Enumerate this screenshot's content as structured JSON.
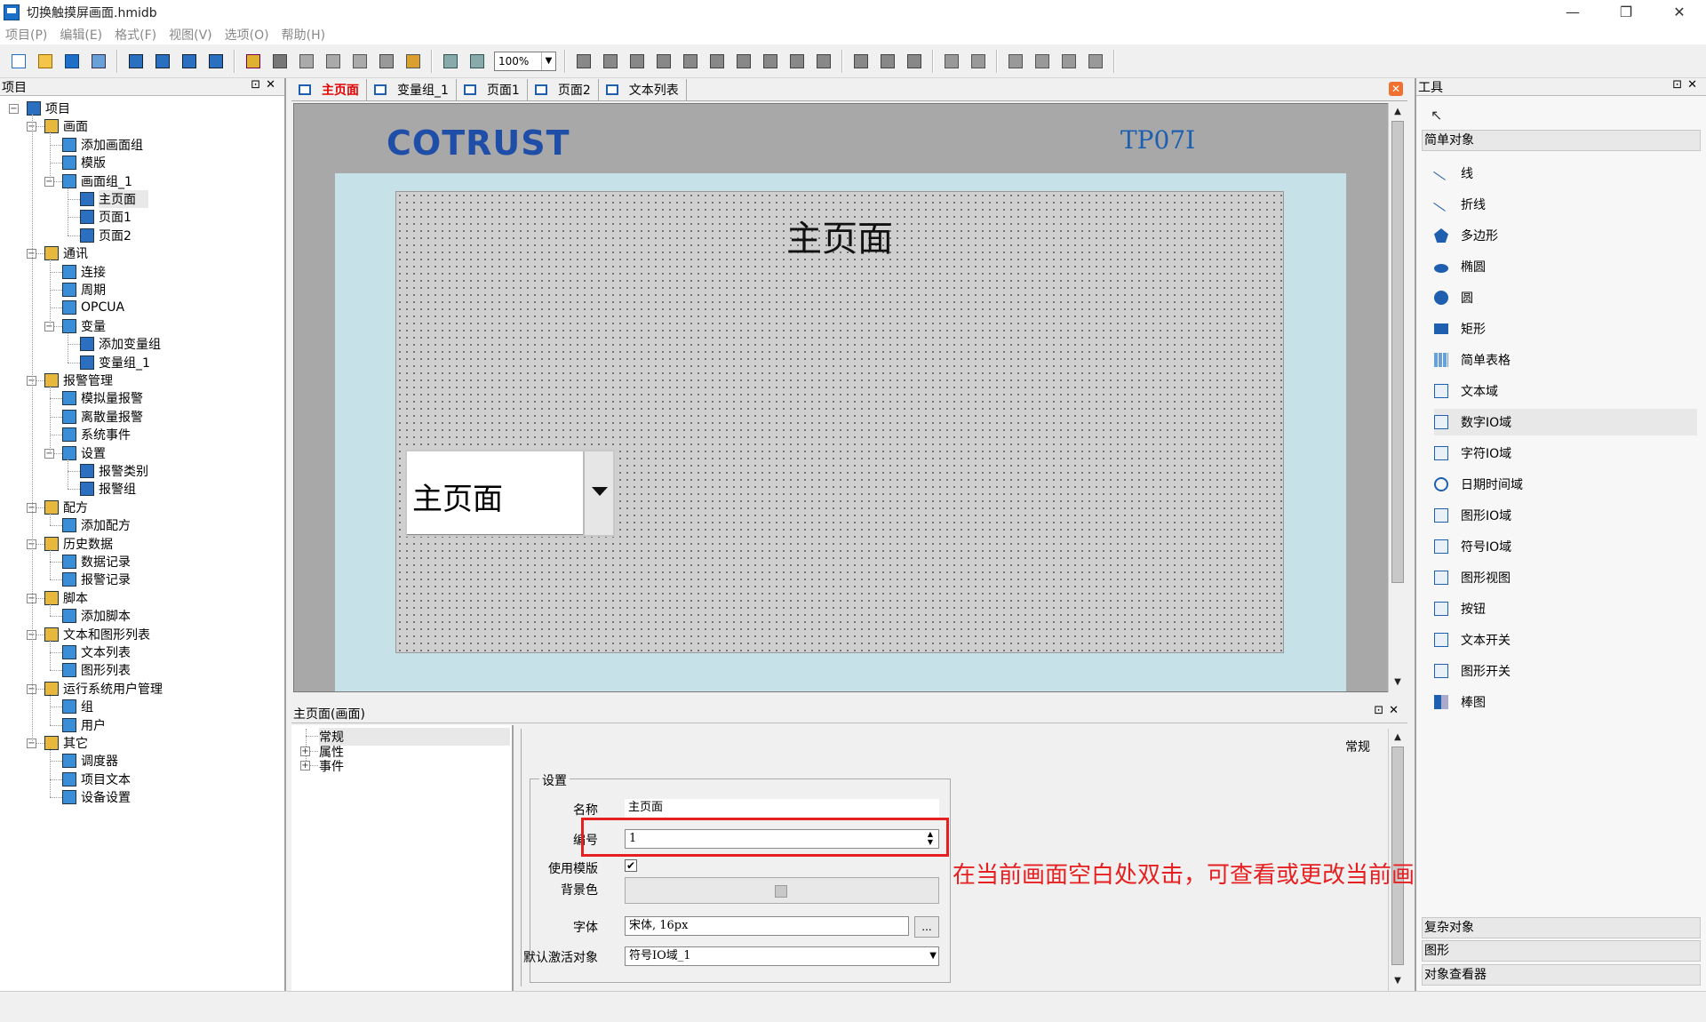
{
  "window": {
    "title": "切换触摸屏画面.hmidb",
    "min": "—",
    "max": "❐",
    "close": "✕"
  },
  "menu": [
    "项目(P)",
    "编辑(E)",
    "格式(F)",
    "视图(V)",
    "选项(O)",
    "帮助(H)"
  ],
  "toolbar": {
    "zoom": "100%"
  },
  "project_panel": {
    "title": "项目"
  },
  "tree": [
    {
      "label": "项目",
      "level": 0,
      "icon": "project-icon",
      "expand": "−"
    },
    {
      "label": "画面",
      "level": 1,
      "icon": "screen-folder-icon",
      "expand": "−"
    },
    {
      "label": "添加画面组",
      "level": 2,
      "icon": "add-screen-group-icon"
    },
    {
      "label": "模版",
      "level": 2,
      "icon": "template-icon"
    },
    {
      "label": "画面组_1",
      "level": 2,
      "icon": "screen-group-icon",
      "expand": "−"
    },
    {
      "label": "主页面",
      "level": 3,
      "icon": "screen-icon",
      "selected": true
    },
    {
      "label": "页面1",
      "level": 3,
      "icon": "screen-icon"
    },
    {
      "label": "页面2",
      "level": 3,
      "icon": "screen-icon"
    },
    {
      "label": "通讯",
      "level": 1,
      "icon": "communication-icon",
      "expand": "−"
    },
    {
      "label": "连接",
      "level": 2,
      "icon": "connection-icon"
    },
    {
      "label": "周期",
      "level": 2,
      "icon": "cycle-icon"
    },
    {
      "label": "OPCUA",
      "level": 2,
      "icon": "opcua-icon"
    },
    {
      "label": "变量",
      "level": 2,
      "icon": "variable-icon",
      "expand": "−"
    },
    {
      "label": "添加变量组",
      "level": 3,
      "icon": "add-variable-group-icon"
    },
    {
      "label": "变量组_1",
      "level": 3,
      "icon": "variable-group-icon"
    },
    {
      "label": "报警管理",
      "level": 1,
      "icon": "alarm-management-icon",
      "expand": "−"
    },
    {
      "label": "模拟量报警",
      "level": 2,
      "icon": "analog-alarm-icon"
    },
    {
      "label": "离散量报警",
      "level": 2,
      "icon": "discrete-alarm-icon"
    },
    {
      "label": "系统事件",
      "level": 2,
      "icon": "system-event-icon"
    },
    {
      "label": "设置",
      "level": 2,
      "icon": "alarm-settings-icon",
      "expand": "−"
    },
    {
      "label": "报警类别",
      "level": 3,
      "icon": "alarm-class-icon"
    },
    {
      "label": "报警组",
      "level": 3,
      "icon": "alarm-group-icon"
    },
    {
      "label": "配方",
      "level": 1,
      "icon": "recipe-icon",
      "expand": "−"
    },
    {
      "label": "添加配方",
      "level": 2,
      "icon": "add-recipe-icon"
    },
    {
      "label": "历史数据",
      "level": 1,
      "icon": "history-data-icon",
      "expand": "−"
    },
    {
      "label": "数据记录",
      "level": 2,
      "icon": "data-log-icon"
    },
    {
      "label": "报警记录",
      "level": 2,
      "icon": "alarm-log-icon"
    },
    {
      "label": "脚本",
      "level": 1,
      "icon": "script-icon",
      "expand": "−"
    },
    {
      "label": "添加脚本",
      "level": 2,
      "icon": "add-script-icon"
    },
    {
      "label": "文本和图形列表",
      "level": 1,
      "icon": "text-graphic-list-icon",
      "expand": "−"
    },
    {
      "label": "文本列表",
      "level": 2,
      "icon": "text-list-icon"
    },
    {
      "label": "图形列表",
      "level": 2,
      "icon": "graphic-list-icon"
    },
    {
      "label": "运行系统用户管理",
      "level": 1,
      "icon": "user-management-icon",
      "expand": "−"
    },
    {
      "label": "组",
      "level": 2,
      "icon": "group-icon"
    },
    {
      "label": "用户",
      "level": 2,
      "icon": "user-icon"
    },
    {
      "label": "其它",
      "level": 1,
      "icon": "other-icon",
      "expand": "−"
    },
    {
      "label": "调度器",
      "level": 2,
      "icon": "scheduler-icon"
    },
    {
      "label": "项目文本",
      "level": 2,
      "icon": "project-text-icon"
    },
    {
      "label": "设备设置",
      "level": 2,
      "icon": "device-settings-icon"
    }
  ],
  "tabs": [
    {
      "label": "主页面",
      "active": true
    },
    {
      "label": "变量组_1"
    },
    {
      "label": "页面1"
    },
    {
      "label": "页面2"
    },
    {
      "label": "文本列表"
    }
  ],
  "canvas": {
    "logo": "COTRUST",
    "model": "TP07I",
    "page_title": "主页面",
    "combo_value": "主页面"
  },
  "properties": {
    "header": "主页面(画面)",
    "nav": [
      "常规",
      "属性",
      "事件"
    ],
    "section": "常规",
    "group": "设置",
    "name_label": "名称",
    "name_value": "主页面",
    "number_label": "编号",
    "number_value": "1",
    "use_template_label": "使用模版",
    "bgcolor_label": "背景色",
    "font_label": "字体",
    "font_value": "宋体, 16px",
    "font_btn": "...",
    "default_active_label": "默认激活对象",
    "default_active_value": "符号IO域_1"
  },
  "annotation": "在当前画面空白处双击，可查看或更改当前画面编号",
  "tools_panel": {
    "title": "工具",
    "simple_section": "简单对象",
    "complex_section": "复杂对象",
    "graphic_section": "图形",
    "inspector_section": "对象查看器"
  },
  "tools": [
    "线",
    "折线",
    "多边形",
    "椭圆",
    "圆",
    "矩形",
    "简单表格",
    "文本域",
    "数字IO域",
    "字符IO域",
    "日期时间域",
    "图形IO域",
    "符号IO域",
    "图形视图",
    "按钮",
    "文本开关",
    "图形开关",
    "棒图"
  ],
  "colors": {
    "accent_red": "#e62020",
    "brand_blue": "#1f4ea8",
    "screen_bg": "#c6e2e8"
  }
}
